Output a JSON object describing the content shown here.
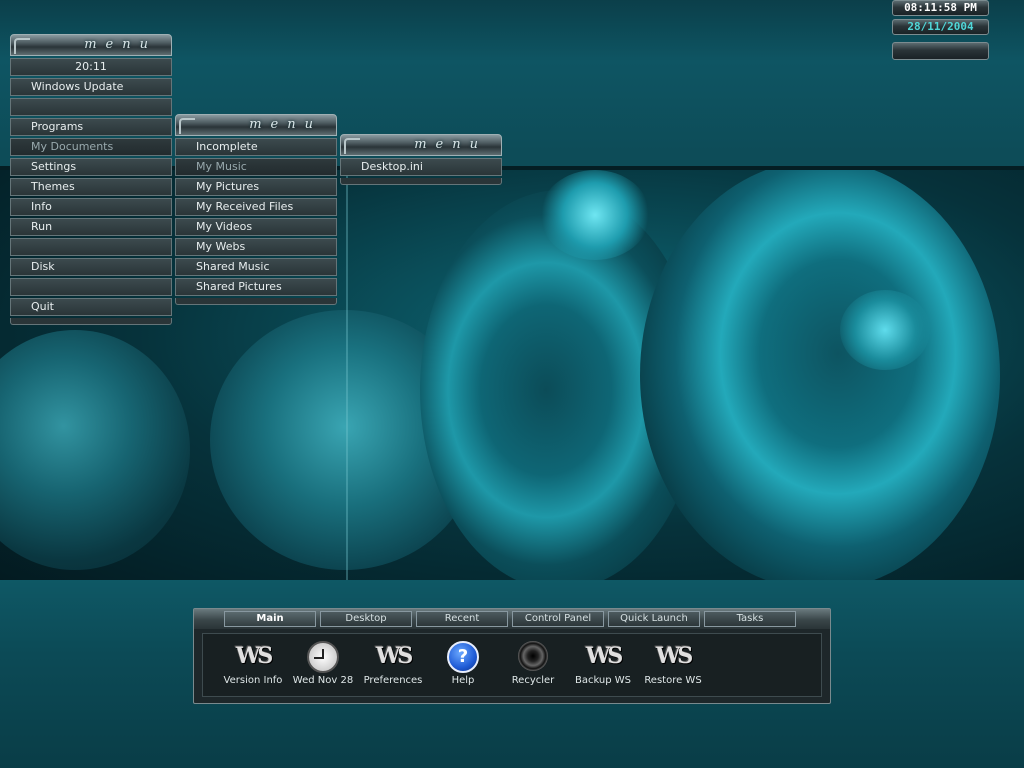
{
  "clock": {
    "time": "08:11:58 PM",
    "date": "28/11/2004"
  },
  "menus": {
    "main": {
      "title": "menu",
      "items": [
        {
          "label": "20:11"
        },
        {
          "label": "Windows Update"
        },
        {
          "label": ""
        },
        {
          "label": "Programs"
        },
        {
          "label": "My Documents"
        },
        {
          "label": "Settings"
        },
        {
          "label": "Themes"
        },
        {
          "label": "Info"
        },
        {
          "label": "Run"
        },
        {
          "label": ""
        },
        {
          "label": "Disk"
        },
        {
          "label": ""
        },
        {
          "label": "Quit"
        }
      ]
    },
    "documents": {
      "title": "menu",
      "items": [
        {
          "label": "Incomplete"
        },
        {
          "label": "My Music"
        },
        {
          "label": "My Pictures"
        },
        {
          "label": "My Received Files"
        },
        {
          "label": "My Videos"
        },
        {
          "label": "My Webs"
        },
        {
          "label": "Shared Music"
        },
        {
          "label": "Shared Pictures"
        }
      ]
    },
    "music": {
      "title": "menu",
      "items": [
        {
          "label": "Desktop.ini"
        }
      ]
    }
  },
  "bar": {
    "tabs": [
      {
        "label": "Main"
      },
      {
        "label": "Desktop"
      },
      {
        "label": "Recent"
      },
      {
        "label": "Control Panel"
      },
      {
        "label": "Quick Launch"
      },
      {
        "label": "Tasks"
      }
    ],
    "launchers": [
      {
        "label": "Version Info",
        "icon": "ws-logo-icon"
      },
      {
        "label": "Wed Nov 28",
        "icon": "clock-icon"
      },
      {
        "label": "Preferences",
        "icon": "ws-logo-icon"
      },
      {
        "label": "Help",
        "icon": "help-icon"
      },
      {
        "label": "Recycler",
        "icon": "recycler-icon"
      },
      {
        "label": "Backup WS",
        "icon": "ws-logo-icon"
      },
      {
        "label": "Restore WS",
        "icon": "ws-logo-icon"
      }
    ],
    "ws_logo_text": "WS",
    "help_glyph": "?"
  }
}
